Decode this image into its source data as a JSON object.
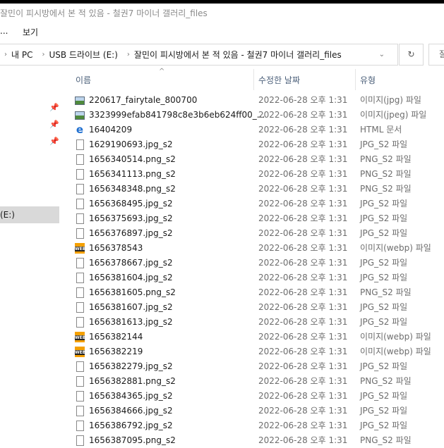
{
  "window": {
    "title": "잘민이 피시방에서 본 적 있음 - 철권7 마이너 갤러리_files"
  },
  "menu": {
    "partial_item": "...",
    "view": "보기"
  },
  "address": {
    "crumbs": [
      "내 PC",
      "USB 드라이브 (E:)",
      "잘민이 피시방에서 본 적 있음 - 철권7 마이너 갤러리_files"
    ],
    "refresh_icon": "refresh-icon",
    "search_partial": "잘"
  },
  "nav": {
    "selected": "(E:)"
  },
  "columns": {
    "name": "이름",
    "date": "수정한 날짜",
    "type": "유형"
  },
  "files": [
    {
      "name": "220617_fairytale_800700",
      "date": "2022-06-28 오후 1:31",
      "type": "이미지(jpg) 파일",
      "icon": "image"
    },
    {
      "name": "3323999efab841798c8e3b6eb624ff00_...",
      "date": "2022-06-28 오후 1:31",
      "type": "이미지(jpeg) 파일",
      "icon": "image"
    },
    {
      "name": "16404209",
      "date": "2022-06-28 오후 1:31",
      "type": "HTML 문서",
      "icon": "ie"
    },
    {
      "name": "1629190693.jpg_s2",
      "date": "2022-06-28 오후 1:31",
      "type": "JPG_S2 파일",
      "icon": "doc"
    },
    {
      "name": "1656340514.png_s2",
      "date": "2022-06-28 오후 1:31",
      "type": "PNG_S2 파일",
      "icon": "doc"
    },
    {
      "name": "1656341113.png_s2",
      "date": "2022-06-28 오후 1:31",
      "type": "PNG_S2 파일",
      "icon": "doc"
    },
    {
      "name": "1656348348.png_s2",
      "date": "2022-06-28 오후 1:31",
      "type": "PNG_S2 파일",
      "icon": "doc"
    },
    {
      "name": "1656368495.jpg_s2",
      "date": "2022-06-28 오후 1:31",
      "type": "JPG_S2 파일",
      "icon": "doc"
    },
    {
      "name": "1656375693.jpg_s2",
      "date": "2022-06-28 오후 1:31",
      "type": "JPG_S2 파일",
      "icon": "doc"
    },
    {
      "name": "1656376897.jpg_s2",
      "date": "2022-06-28 오후 1:31",
      "type": "JPG_S2 파일",
      "icon": "doc"
    },
    {
      "name": "1656378543",
      "date": "2022-06-28 오후 1:31",
      "type": "이미지(webp) 파일",
      "icon": "webp"
    },
    {
      "name": "1656378667.jpg_s2",
      "date": "2022-06-28 오후 1:31",
      "type": "JPG_S2 파일",
      "icon": "doc"
    },
    {
      "name": "1656381604.jpg_s2",
      "date": "2022-06-28 오후 1:31",
      "type": "JPG_S2 파일",
      "icon": "doc"
    },
    {
      "name": "1656381605.png_s2",
      "date": "2022-06-28 오후 1:31",
      "type": "PNG_S2 파일",
      "icon": "doc"
    },
    {
      "name": "1656381607.jpg_s2",
      "date": "2022-06-28 오후 1:31",
      "type": "JPG_S2 파일",
      "icon": "doc"
    },
    {
      "name": "1656381613.jpg_s2",
      "date": "2022-06-28 오후 1:31",
      "type": "JPG_S2 파일",
      "icon": "doc"
    },
    {
      "name": "1656382144",
      "date": "2022-06-28 오후 1:31",
      "type": "이미지(webp) 파일",
      "icon": "webp"
    },
    {
      "name": "1656382219",
      "date": "2022-06-28 오후 1:31",
      "type": "이미지(webp) 파일",
      "icon": "webp"
    },
    {
      "name": "1656382279.jpg_s2",
      "date": "2022-06-28 오후 1:31",
      "type": "JPG_S2 파일",
      "icon": "doc"
    },
    {
      "name": "1656382881.png_s2",
      "date": "2022-06-28 오후 1:31",
      "type": "PNG_S2 파일",
      "icon": "doc"
    },
    {
      "name": "1656384365.jpg_s2",
      "date": "2022-06-28 오후 1:31",
      "type": "JPG_S2 파일",
      "icon": "doc"
    },
    {
      "name": "1656384666.jpg_s2",
      "date": "2022-06-28 오후 1:31",
      "type": "JPG_S2 파일",
      "icon": "doc"
    },
    {
      "name": "1656386792.jpg_s2",
      "date": "2022-06-28 오후 1:31",
      "type": "JPG_S2 파일",
      "icon": "doc"
    },
    {
      "name": "1656387095.png_s2",
      "date": "2022-06-28 오후 1:31",
      "type": "PNG_S2 파일",
      "icon": "doc"
    }
  ]
}
